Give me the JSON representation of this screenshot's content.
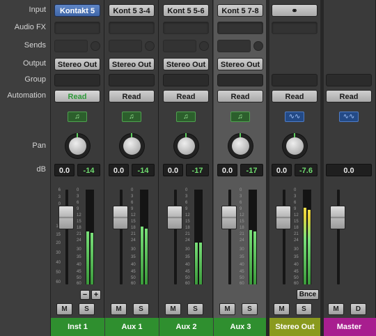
{
  "row_labels": {
    "input": "Input",
    "audio_fx": "Audio FX",
    "sends": "Sends",
    "output": "Output",
    "group": "Group",
    "automation": "Automation",
    "pan": "Pan",
    "db": "dB"
  },
  "fader_scale": [
    "6",
    "3",
    "0",
    "3",
    "6",
    "10",
    "15",
    "20",
    "30",
    "40",
    "50",
    "60"
  ],
  "meter_scale": [
    "0",
    "3",
    "6",
    "9",
    "12",
    "15",
    "18",
    "21",
    "24",
    "30",
    "35",
    "40",
    "45",
    "50",
    "60"
  ],
  "colors": {
    "inst": "#2f8f2f",
    "aux": "#2f8f2f",
    "stereo_out": "#8a9a1e",
    "master": "#a81e8f"
  },
  "strips": [
    {
      "name": "Inst 1",
      "input": "Kontakt 5",
      "output": "Stereo Out",
      "automation": "Read",
      "type": "midi",
      "volume": "0.0",
      "peak": "-14",
      "plus_minus": [
        "−",
        "+"
      ],
      "mute": "M",
      "solo": "S",
      "level_l": 0.57,
      "level_r": 0.55,
      "name_color": "#2f8f2f"
    },
    {
      "name": "Aux 1",
      "input": "Kont 5 3-4",
      "output": "Stereo Out",
      "automation": "Read",
      "type": "midi",
      "volume": "0.0",
      "peak": "-14",
      "mute": "M",
      "solo": "S",
      "level_l": 0.62,
      "level_r": 0.6,
      "name_color": "#2f8f2f"
    },
    {
      "name": "Aux 2",
      "input": "Kont 5 5-6",
      "output": "Stereo Out",
      "automation": "Read",
      "type": "midi",
      "volume": "0.0",
      "peak": "-17",
      "mute": "M",
      "solo": "S",
      "level_l": 0.45,
      "level_r": 0.45,
      "name_color": "#2f8f2f"
    },
    {
      "name": "Aux 3",
      "input": "Kont 5 7-8",
      "output": "Stereo Out",
      "automation": "Read",
      "type": "midi",
      "volume": "0.0",
      "peak": "-17",
      "mute": "M",
      "solo": "S",
      "level_l": 0.58,
      "level_r": 0.57,
      "name_color": "#2f8f2f"
    },
    {
      "name": "Stereo Out",
      "input": "",
      "output": "",
      "automation": "Read",
      "type": "audio",
      "volume": "0.0",
      "peak": "-7.6",
      "bounce": "Bnce",
      "mute": "M",
      "solo": "S",
      "level_l": 0.82,
      "level_r": 0.8,
      "name_color": "#8a9a1e"
    },
    {
      "name": "Master",
      "input": "",
      "output": "",
      "automation": "Read",
      "type": "audio",
      "volume": "0.0",
      "mute": "M",
      "solo": "D",
      "name_color": "#a81e8f"
    }
  ]
}
